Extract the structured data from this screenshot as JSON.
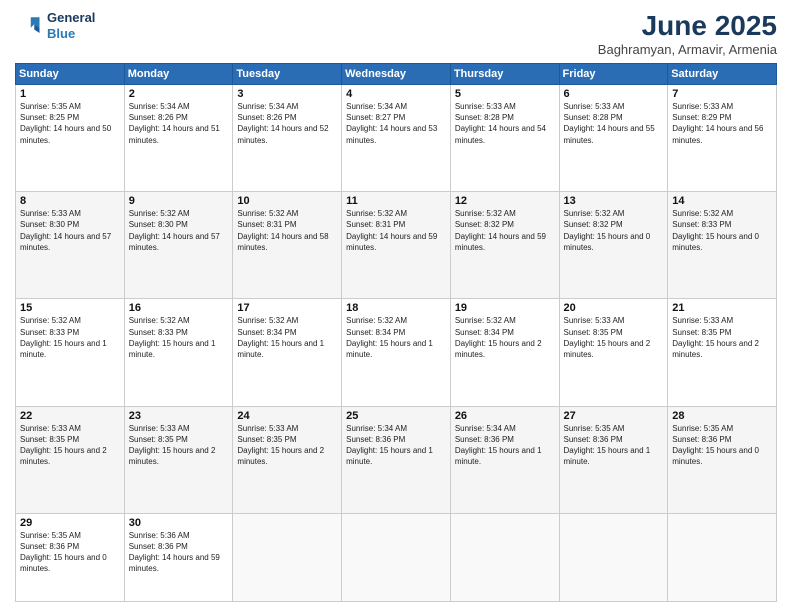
{
  "header": {
    "logo_line1": "General",
    "logo_line2": "Blue",
    "month": "June 2025",
    "location": "Baghramyan, Armavir, Armenia"
  },
  "days_of_week": [
    "Sunday",
    "Monday",
    "Tuesday",
    "Wednesday",
    "Thursday",
    "Friday",
    "Saturday"
  ],
  "weeks": [
    [
      {
        "day": 1,
        "sunrise": "5:35 AM",
        "sunset": "8:25 PM",
        "daylight": "14 hours and 50 minutes."
      },
      {
        "day": 2,
        "sunrise": "5:34 AM",
        "sunset": "8:26 PM",
        "daylight": "14 hours and 51 minutes."
      },
      {
        "day": 3,
        "sunrise": "5:34 AM",
        "sunset": "8:26 PM",
        "daylight": "14 hours and 52 minutes."
      },
      {
        "day": 4,
        "sunrise": "5:34 AM",
        "sunset": "8:27 PM",
        "daylight": "14 hours and 53 minutes."
      },
      {
        "day": 5,
        "sunrise": "5:33 AM",
        "sunset": "8:28 PM",
        "daylight": "14 hours and 54 minutes."
      },
      {
        "day": 6,
        "sunrise": "5:33 AM",
        "sunset": "8:28 PM",
        "daylight": "14 hours and 55 minutes."
      },
      {
        "day": 7,
        "sunrise": "5:33 AM",
        "sunset": "8:29 PM",
        "daylight": "14 hours and 56 minutes."
      }
    ],
    [
      {
        "day": 8,
        "sunrise": "5:33 AM",
        "sunset": "8:30 PM",
        "daylight": "14 hours and 57 minutes."
      },
      {
        "day": 9,
        "sunrise": "5:32 AM",
        "sunset": "8:30 PM",
        "daylight": "14 hours and 57 minutes."
      },
      {
        "day": 10,
        "sunrise": "5:32 AM",
        "sunset": "8:31 PM",
        "daylight": "14 hours and 58 minutes."
      },
      {
        "day": 11,
        "sunrise": "5:32 AM",
        "sunset": "8:31 PM",
        "daylight": "14 hours and 59 minutes."
      },
      {
        "day": 12,
        "sunrise": "5:32 AM",
        "sunset": "8:32 PM",
        "daylight": "14 hours and 59 minutes."
      },
      {
        "day": 13,
        "sunrise": "5:32 AM",
        "sunset": "8:32 PM",
        "daylight": "15 hours and 0 minutes."
      },
      {
        "day": 14,
        "sunrise": "5:32 AM",
        "sunset": "8:33 PM",
        "daylight": "15 hours and 0 minutes."
      }
    ],
    [
      {
        "day": 15,
        "sunrise": "5:32 AM",
        "sunset": "8:33 PM",
        "daylight": "15 hours and 1 minute."
      },
      {
        "day": 16,
        "sunrise": "5:32 AM",
        "sunset": "8:33 PM",
        "daylight": "15 hours and 1 minute."
      },
      {
        "day": 17,
        "sunrise": "5:32 AM",
        "sunset": "8:34 PM",
        "daylight": "15 hours and 1 minute."
      },
      {
        "day": 18,
        "sunrise": "5:32 AM",
        "sunset": "8:34 PM",
        "daylight": "15 hours and 1 minute."
      },
      {
        "day": 19,
        "sunrise": "5:32 AM",
        "sunset": "8:34 PM",
        "daylight": "15 hours and 2 minutes."
      },
      {
        "day": 20,
        "sunrise": "5:33 AM",
        "sunset": "8:35 PM",
        "daylight": "15 hours and 2 minutes."
      },
      {
        "day": 21,
        "sunrise": "5:33 AM",
        "sunset": "8:35 PM",
        "daylight": "15 hours and 2 minutes."
      }
    ],
    [
      {
        "day": 22,
        "sunrise": "5:33 AM",
        "sunset": "8:35 PM",
        "daylight": "15 hours and 2 minutes."
      },
      {
        "day": 23,
        "sunrise": "5:33 AM",
        "sunset": "8:35 PM",
        "daylight": "15 hours and 2 minutes."
      },
      {
        "day": 24,
        "sunrise": "5:33 AM",
        "sunset": "8:35 PM",
        "daylight": "15 hours and 2 minutes."
      },
      {
        "day": 25,
        "sunrise": "5:34 AM",
        "sunset": "8:36 PM",
        "daylight": "15 hours and 1 minute."
      },
      {
        "day": 26,
        "sunrise": "5:34 AM",
        "sunset": "8:36 PM",
        "daylight": "15 hours and 1 minute."
      },
      {
        "day": 27,
        "sunrise": "5:35 AM",
        "sunset": "8:36 PM",
        "daylight": "15 hours and 1 minute."
      },
      {
        "day": 28,
        "sunrise": "5:35 AM",
        "sunset": "8:36 PM",
        "daylight": "15 hours and 0 minutes."
      }
    ],
    [
      {
        "day": 29,
        "sunrise": "5:35 AM",
        "sunset": "8:36 PM",
        "daylight": "15 hours and 0 minutes."
      },
      {
        "day": 30,
        "sunrise": "5:36 AM",
        "sunset": "8:36 PM",
        "daylight": "14 hours and 59 minutes."
      },
      null,
      null,
      null,
      null,
      null
    ]
  ]
}
